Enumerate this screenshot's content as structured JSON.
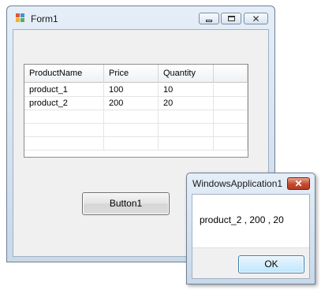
{
  "form": {
    "title": "Form1",
    "button1_label": "Button1",
    "controls": {
      "minimize_icon": "minimize-icon",
      "maximize_icon": "maximize-icon",
      "close_icon": "close-icon",
      "close_glyph": "✕"
    },
    "grid": {
      "columns": [
        "ProductName",
        "Price",
        "Quantity"
      ],
      "rows": [
        [
          "product_1",
          "100",
          "10"
        ],
        [
          "product_2",
          "200",
          "20"
        ]
      ]
    }
  },
  "messagebox": {
    "title": "WindowsApplication1",
    "close_glyph": "✕",
    "message": "product_2 , 200 , 20",
    "ok_label": "OK"
  },
  "colors": {
    "frame": "#c9d9ea",
    "client": "#f0f0f0",
    "close_red": "#c44a2e"
  }
}
